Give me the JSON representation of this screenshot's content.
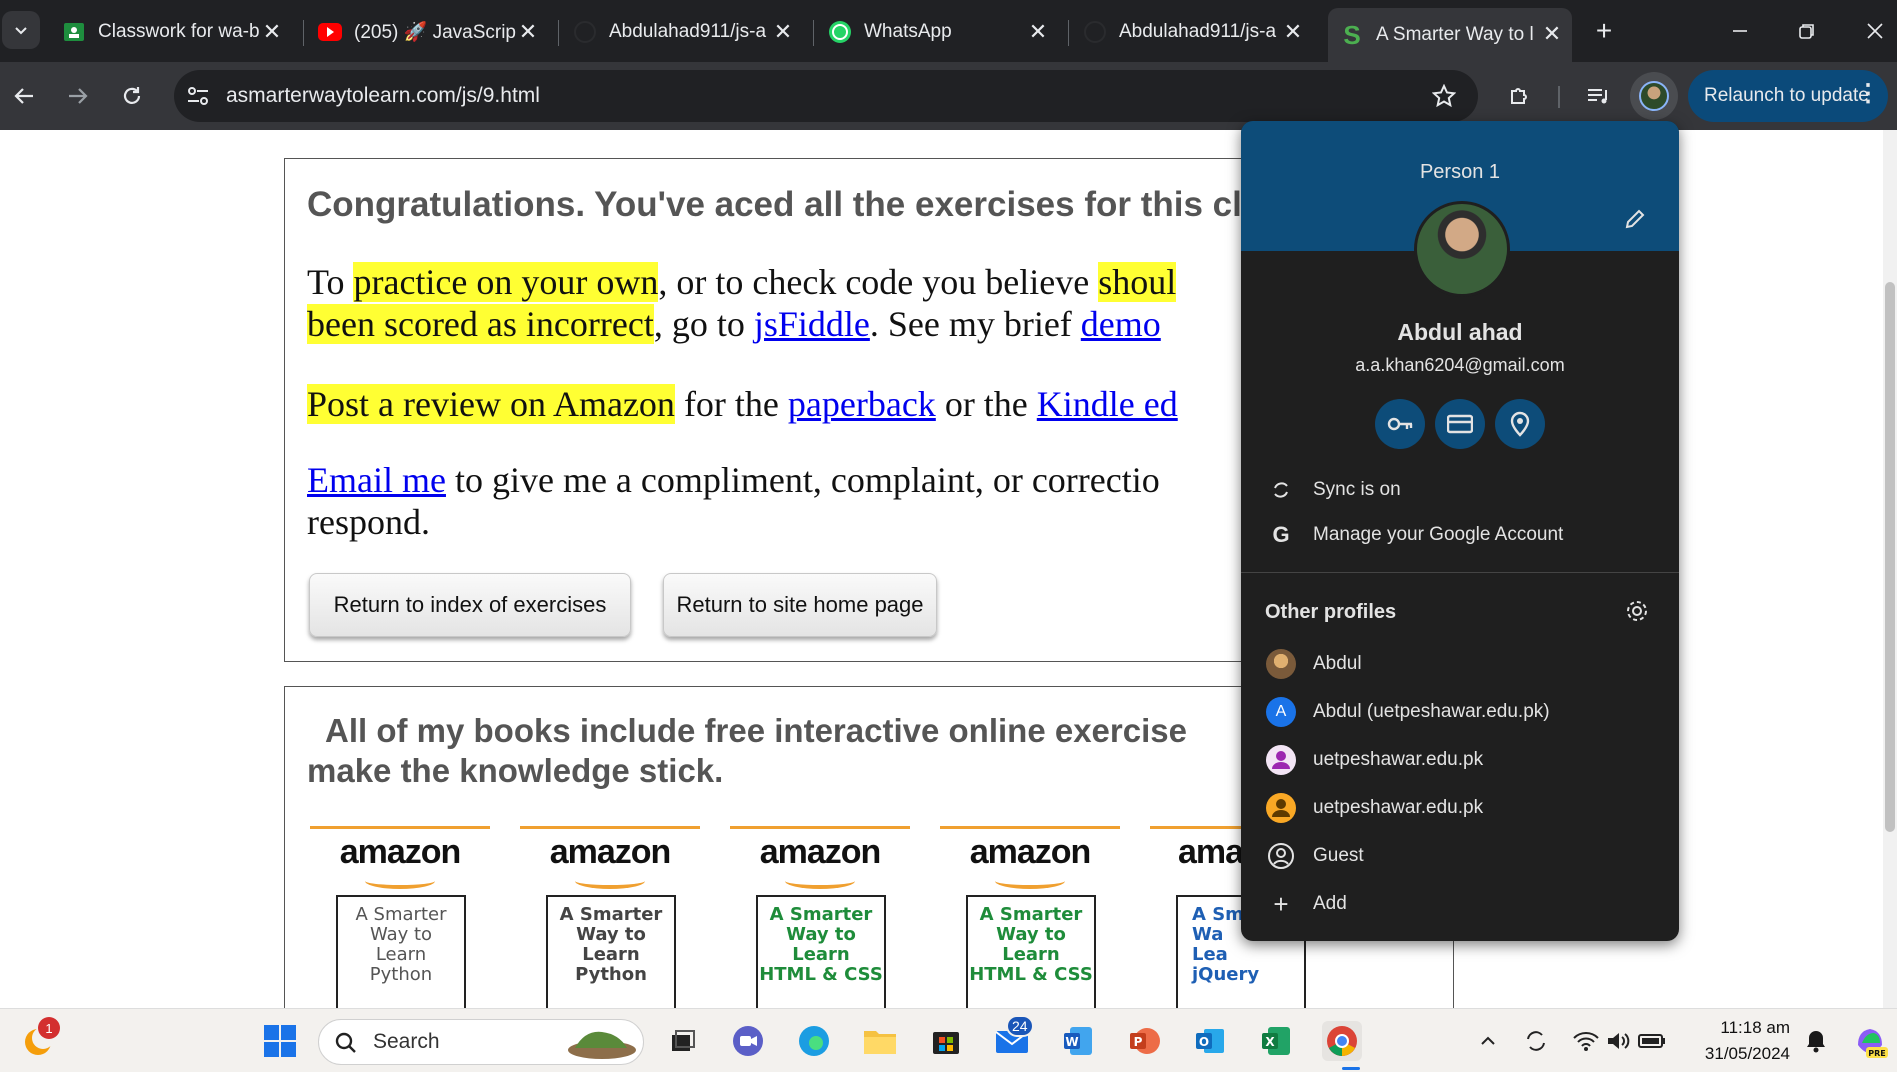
{
  "browser": {
    "tabs": [
      {
        "title": "Classwork for wa-b",
        "icon": "classroom-icon"
      },
      {
        "title": "(205) 🚀 JavaScrip",
        "icon": "youtube-icon"
      },
      {
        "title": "Abdulahad911/js-a",
        "icon": "github-icon"
      },
      {
        "title": "WhatsApp",
        "icon": "whatsapp-icon"
      },
      {
        "title": "Abdulahad911/js-a",
        "icon": "github-icon"
      },
      {
        "title": "A Smarter Way to l",
        "icon": "site-s-icon",
        "active": true
      }
    ],
    "url": "asmarterwaytolearn.com/js/9.html",
    "relaunch_label": "Relaunch to update"
  },
  "page": {
    "congrats_heading": "Congratulations. You've aced all the exercises for this cl",
    "p1": {
      "t1": "To ",
      "hl1": "practice on your own",
      "t2": ", or to check code you believe ",
      "hl2": "shoul",
      "hl3": "been scored as incorrect",
      "t3": ", go to ",
      "link1": "jsFiddle",
      "t4": ". See my brief ",
      "link2": "demo"
    },
    "p2": {
      "hl": "Post a review on Amazon",
      "t1": " for the ",
      "link1": "paperback",
      "t2": " or the ",
      "link2": "Kindle ed"
    },
    "p3": {
      "link": "Email me",
      "t1": " to give me a compliment, complaint, or correctio",
      "t2": "respond."
    },
    "buttons": {
      "index": "Return to index of exercises",
      "home": "Return to site home page"
    },
    "books_heading_l1": "All of my books include free interactive online exercise",
    "books_heading_l2": "make the knowledge stick.",
    "books": [
      {
        "brand": "amazon",
        "cover": [
          "A Smarter",
          "Way to",
          "Learn",
          "Python"
        ],
        "color": "#555555"
      },
      {
        "brand": "amazon",
        "cover": [
          "A Smarter",
          "Way to",
          "Learn",
          "Python"
        ],
        "color": "#444444"
      },
      {
        "brand": "amazon",
        "cover": [
          "A Smarter",
          "Way to",
          "Learn",
          "HTML & CSS"
        ],
        "color": "#1e8c3a"
      },
      {
        "brand": "amazon",
        "cover": [
          "A Smarter",
          "Way to",
          "Learn",
          "HTML & CSS"
        ],
        "color": "#1e8c3a"
      },
      {
        "brand": "ama",
        "cover": [
          "A Sm",
          "Wa",
          "Lea",
          "jQuery"
        ],
        "color": "#1e5fb4"
      }
    ]
  },
  "profile": {
    "person_label": "Person 1",
    "name": "Abdul ahad",
    "email": "a.a.khan6204@gmail.com",
    "sync": "Sync is on",
    "manage": "Manage your Google Account",
    "other_profiles": "Other profiles",
    "profiles": [
      {
        "label": "Abdul",
        "avatar": "photo"
      },
      {
        "label": "Abdul (uetpeshawar.edu.pk)",
        "avatar": "A"
      },
      {
        "label": "uetpeshawar.edu.pk",
        "avatar": "person-purple"
      },
      {
        "label": "uetpeshawar.edu.pk",
        "avatar": "person-orange"
      },
      {
        "label": "Guest",
        "avatar": "guest"
      },
      {
        "label": "Add",
        "avatar": "plus"
      }
    ]
  },
  "taskbar": {
    "search_placeholder": "Search",
    "time": "11:18 am",
    "date": "31/05/2024",
    "notification_badge": "1",
    "mail_badge": "24"
  }
}
